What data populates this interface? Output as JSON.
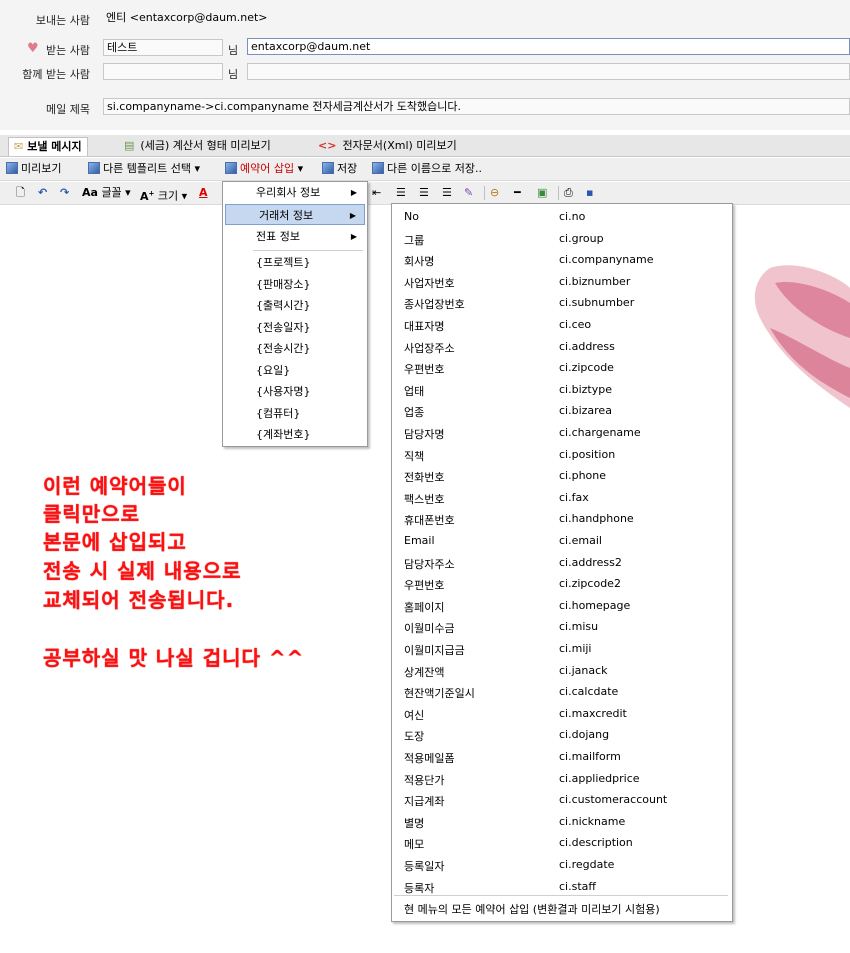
{
  "header": {
    "sender_label": "보내는 사람",
    "sender_value": "엔티 <entaxcorp@daum.net>",
    "recipient_label": "받는 사람",
    "recipient_name": "테스트",
    "recipient_suffix": "님",
    "recipient_email": "entaxcorp@daum.net",
    "cc_label": "함께 받는 사람",
    "cc_suffix": "님",
    "cc_name": "",
    "cc_email": "",
    "subject_label": "메일 제목",
    "subject_value": "si.companyname->ci.companyname 전자세금계산서가 도착했습니다."
  },
  "tabs": [
    {
      "label": "보낼 메시지"
    },
    {
      "label": "(세금) 계산서 형태 미리보기"
    },
    {
      "label": "전자문서(Xml) 미리보기"
    }
  ],
  "toolbar1": {
    "preview": "미리보기",
    "template": "다른 템플리트 선택",
    "insert_keyword": "예약어 삽입",
    "save": "저장",
    "save_as": "다른 이름으로 저장.."
  },
  "toolbar2": {
    "font": "글꼴",
    "size": "크기"
  },
  "menu1": {
    "items": [
      {
        "label": "우리회사 정보"
      },
      {
        "label": "거래처 정보"
      },
      {
        "label": "전표 정보"
      }
    ],
    "keywords": [
      "{프로젝트}",
      "{판매장소}",
      "{출력시간}",
      "{전송일자}",
      "{전송시간}",
      "{요일}",
      "{사용자명}",
      "{컴퓨터}",
      "{계좌번호}"
    ]
  },
  "menu2": {
    "items": [
      {
        "label": "No",
        "code": "ci.no"
      },
      {
        "label": "그룹",
        "code": "ci.group"
      },
      {
        "label": "회사명",
        "code": "ci.companyname"
      },
      {
        "label": "사업자번호",
        "code": "ci.biznumber"
      },
      {
        "label": "종사업장번호",
        "code": "ci.subnumber"
      },
      {
        "label": "대표자명",
        "code": "ci.ceo"
      },
      {
        "label": "사업장주소",
        "code": "ci.address"
      },
      {
        "label": "우편번호",
        "code": "ci.zipcode"
      },
      {
        "label": "업태",
        "code": "ci.biztype"
      },
      {
        "label": "업종",
        "code": "ci.bizarea"
      },
      {
        "label": "담당자명",
        "code": "ci.chargename"
      },
      {
        "label": "직책",
        "code": "ci.position"
      },
      {
        "label": "전화번호",
        "code": "ci.phone"
      },
      {
        "label": "팩스번호",
        "code": "ci.fax"
      },
      {
        "label": "휴대폰번호",
        "code": "ci.handphone"
      },
      {
        "label": "Email",
        "code": "ci.email"
      },
      {
        "label": "담당자주소",
        "code": "ci.address2"
      },
      {
        "label": "우편번호",
        "code": "ci.zipcode2"
      },
      {
        "label": "홈페이지",
        "code": "ci.homepage"
      },
      {
        "label": "이월미수금",
        "code": "ci.misu"
      },
      {
        "label": "이월미지급금",
        "code": "ci.miji"
      },
      {
        "label": "상계잔액",
        "code": "ci.janack"
      },
      {
        "label": "현잔액기준일시",
        "code": "ci.calcdate"
      },
      {
        "label": "여신",
        "code": "ci.maxcredit"
      },
      {
        "label": "도장",
        "code": "ci.dojang"
      },
      {
        "label": "적용메일폼",
        "code": "ci.mailform"
      },
      {
        "label": "적용단가",
        "code": "ci.appliedprice"
      },
      {
        "label": "지급계좌",
        "code": "ci.customeraccount"
      },
      {
        "label": "별명",
        "code": "ci.nickname"
      },
      {
        "label": "메모",
        "code": "ci.description"
      },
      {
        "label": "등록일자",
        "code": "ci.regdate"
      },
      {
        "label": "등록자",
        "code": "ci.staff"
      }
    ],
    "footer": "현 메뉴의 모든 예약어 삽입 (변환결과 미리보기 시험용)"
  },
  "body_text": {
    "line1": "이런 예약어들이",
    "line2": "클릭만으로",
    "line3": "본문에 삽입되고",
    "line4": "전송 시 실제 내용으로",
    "line5": "교체되어 전송됩니다.",
    "line6": "공부하실 맛 나실 겁니다 ^^"
  },
  "colors": {
    "body_text": "#ff1010",
    "menu_highlight": "#c6d7f0",
    "insert_keyword_label": "#cc0000"
  }
}
